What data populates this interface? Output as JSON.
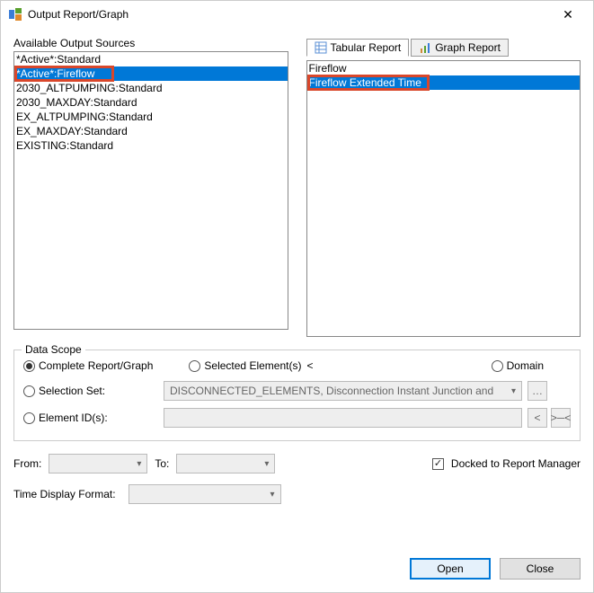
{
  "window": {
    "title": "Output Report/Graph"
  },
  "left": {
    "label": "Available Output Sources",
    "items": [
      "*Active*:Standard",
      "*Active*:Fireflow",
      "2030_ALTPUMPING:Standard",
      "2030_MAXDAY:Standard",
      "EX_ALTPUMPING:Standard",
      "EX_MAXDAY:Standard",
      "EXISTING:Standard"
    ],
    "selected_index": 1
  },
  "right": {
    "tabs": {
      "tabular": "Tabular Report",
      "graph": "Graph Report",
      "active": "tabular"
    },
    "items": [
      "Fireflow",
      "Fireflow Extended Time"
    ],
    "selected_index": 1
  },
  "scope": {
    "legend": "Data Scope",
    "complete": "Complete Report/Graph",
    "selected": "Selected Element(s)",
    "domain": "Domain",
    "selection_set": "Selection Set:",
    "element_ids": "Element ID(s):",
    "selection_combo": "DISCONNECTED_ELEMENTS, Disconnection Instant Junction and",
    "checked": "complete"
  },
  "time": {
    "from": "From:",
    "to": "To:",
    "docked": "Docked to Report Manager",
    "docked_checked": true,
    "display_format": "Time Display Format:"
  },
  "footer": {
    "open": "Open",
    "close": "Close"
  }
}
